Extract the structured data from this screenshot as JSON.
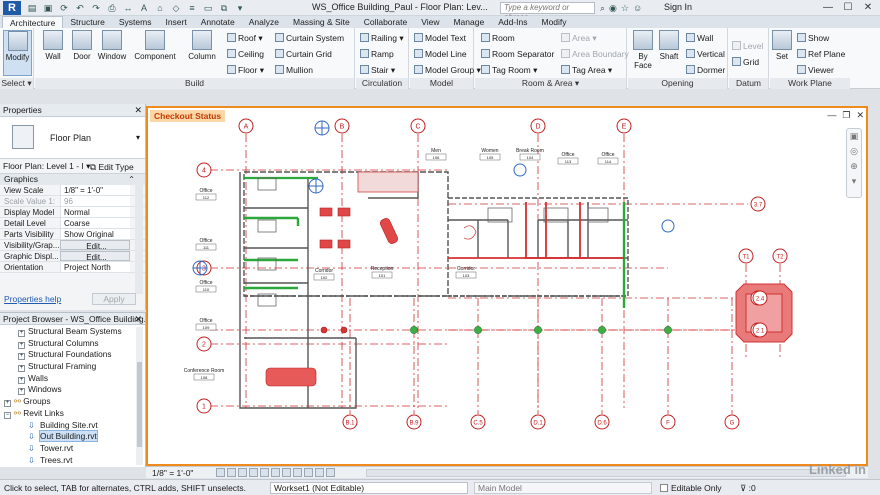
{
  "app": {
    "logo": "R",
    "title": "WS_Office Building_Paul - Floor Plan: Lev...",
    "search_placeholder": "Type a keyword or phrase",
    "signin": "Sign In"
  },
  "tabs": [
    "Architecture",
    "Structure",
    "Systems",
    "Insert",
    "Annotate",
    "Analyze",
    "Massing & Site",
    "Collaborate",
    "View",
    "Manage",
    "Add-Ins",
    "Modify"
  ],
  "ribbon": {
    "modify": "Modify",
    "select": "Select",
    "build": {
      "title": "Build",
      "big": [
        "Wall",
        "Door",
        "Window",
        "Component",
        "Column"
      ],
      "small_col1": [
        "Roof",
        "Ceiling",
        "Floor"
      ],
      "small_col2": [
        "Curtain System",
        "Curtain Grid",
        "Mullion"
      ]
    },
    "circulation": {
      "title": "Circulation",
      "items": [
        "Railing",
        "Ramp",
        "Stair"
      ]
    },
    "model": {
      "title": "Model",
      "items": [
        "Model  Text",
        "Model  Line",
        "Model  Group"
      ]
    },
    "room_area": {
      "title": "Room & Area",
      "col1": [
        "Room",
        "Room  Separator",
        "Tag  Room"
      ],
      "col2": [
        "Area",
        "Area  Boundary",
        "Tag  Area"
      ]
    },
    "opening": {
      "title": "Opening",
      "big": [
        "By Face",
        "Shaft"
      ],
      "small": [
        "Wall",
        "Vertical",
        "Dormer"
      ]
    },
    "datum": {
      "title": "Datum",
      "small": [
        "Level",
        "Grid"
      ]
    },
    "work_plane": {
      "title": "Work Plane",
      "big": "Set",
      "small": [
        "Show",
        "Ref  Plane",
        "Viewer"
      ]
    }
  },
  "properties": {
    "title": "Properties",
    "type_name": "Floor Plan",
    "instance": "Floor Plan: Level 1 - I",
    "edit_type": "Edit Type",
    "group": "Graphics",
    "rows": [
      {
        "k": "View Scale",
        "v": "1/8\" = 1'-0\""
      },
      {
        "k": "Scale Value  1:",
        "v": "96"
      },
      {
        "k": "Display Model",
        "v": "Normal"
      },
      {
        "k": "Detail Level",
        "v": "Coarse"
      },
      {
        "k": "Parts Visibility",
        "v": "Show Original"
      },
      {
        "k": "Visibility/Grap...",
        "v": "Edit..."
      },
      {
        "k": "Graphic Displ...",
        "v": "Edit..."
      },
      {
        "k": "Orientation",
        "v": "Project North"
      }
    ],
    "help": "Properties help",
    "apply": "Apply"
  },
  "browser": {
    "title": "Project Browser - WS_Office Building...",
    "items": [
      {
        "label": "Structural Beam Systems",
        "kind": "tree"
      },
      {
        "label": "Structural Columns",
        "kind": "tree"
      },
      {
        "label": "Structural Foundations",
        "kind": "tree"
      },
      {
        "label": "Structural Framing",
        "kind": "tree"
      },
      {
        "label": "Walls",
        "kind": "tree"
      },
      {
        "label": "Windows",
        "kind": "tree"
      },
      {
        "label": "Groups",
        "kind": "root"
      },
      {
        "label": "Revit Links",
        "kind": "root"
      },
      {
        "label": "Building Site.rvt",
        "kind": "link"
      },
      {
        "label": "Out Building.rvt",
        "kind": "link",
        "selected": true
      },
      {
        "label": "Tower.rvt",
        "kind": "link"
      },
      {
        "label": "Trees.rvt",
        "kind": "link"
      }
    ]
  },
  "view": {
    "checkout_label": "Checkout Status",
    "scale": "1/8\" = 1'-0\"",
    "grid_top": [
      "A",
      "B",
      "C",
      "D",
      "E"
    ],
    "grid_left": [
      "4",
      "3",
      "2",
      "1"
    ],
    "grid_bottom": [
      "B.1",
      "B.9",
      "C.5",
      "D.1",
      "D.6",
      "F",
      "G"
    ],
    "grid_right": [
      "3.7",
      "TA",
      "TB"
    ],
    "grid_tower": [
      "T1",
      "T2",
      "2.4",
      "2.1"
    ],
    "rooms": [
      "Office",
      "Office",
      "Office",
      "Office",
      "Conference Room",
      "Corridor",
      "Reception",
      "Corridor",
      "Men",
      "Women",
      "Break Room",
      "Office",
      "Office"
    ],
    "room_numbers": [
      "112",
      "111",
      "110",
      "109",
      "108",
      "102",
      "101",
      "103",
      "106",
      "105",
      "104",
      "113",
      "114"
    ]
  },
  "status": {
    "hint": "Click to select, TAB for alternates, CTRL adds, SHIFT unselects.",
    "workset": "Workset1 (Not Editable)",
    "model": "Main Model",
    "editable_only": "Editable Only",
    "filter": ":0"
  },
  "watermark": "Linked in"
}
